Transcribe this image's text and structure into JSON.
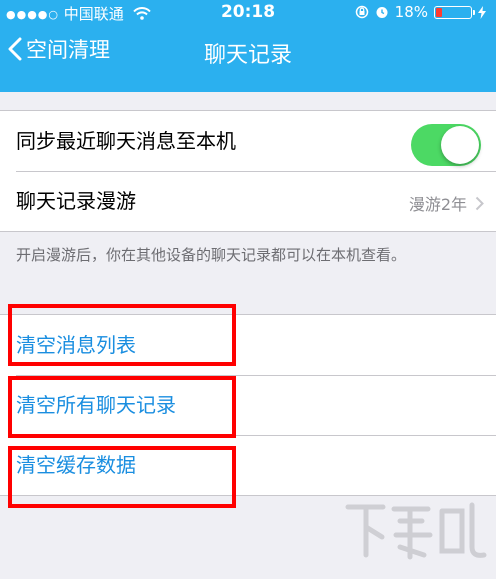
{
  "status_bar": {
    "signal": "●●●●○",
    "carrier": "中国联通",
    "time": "20:18",
    "battery_percent": "18%",
    "battery_level": 0.18
  },
  "nav": {
    "back_label": "空间清理",
    "title": "聊天记录"
  },
  "settings": {
    "sync_label": "同步最近聊天消息至本机",
    "sync_on": true,
    "roaming_label": "聊天记录漫游",
    "roaming_value": "漫游2年",
    "roaming_note": "开启漫游后，你在其他设备的聊天记录都可以在本机查看。"
  },
  "actions": {
    "clear_list": "清空消息列表",
    "clear_history": "清空所有聊天记录",
    "clear_cache": "清空缓存数据"
  },
  "colors": {
    "nav": "#2bb0ef",
    "switch_on": "#4cd964",
    "action_text": "#1a8ee0",
    "highlight": "#ff0000"
  }
}
